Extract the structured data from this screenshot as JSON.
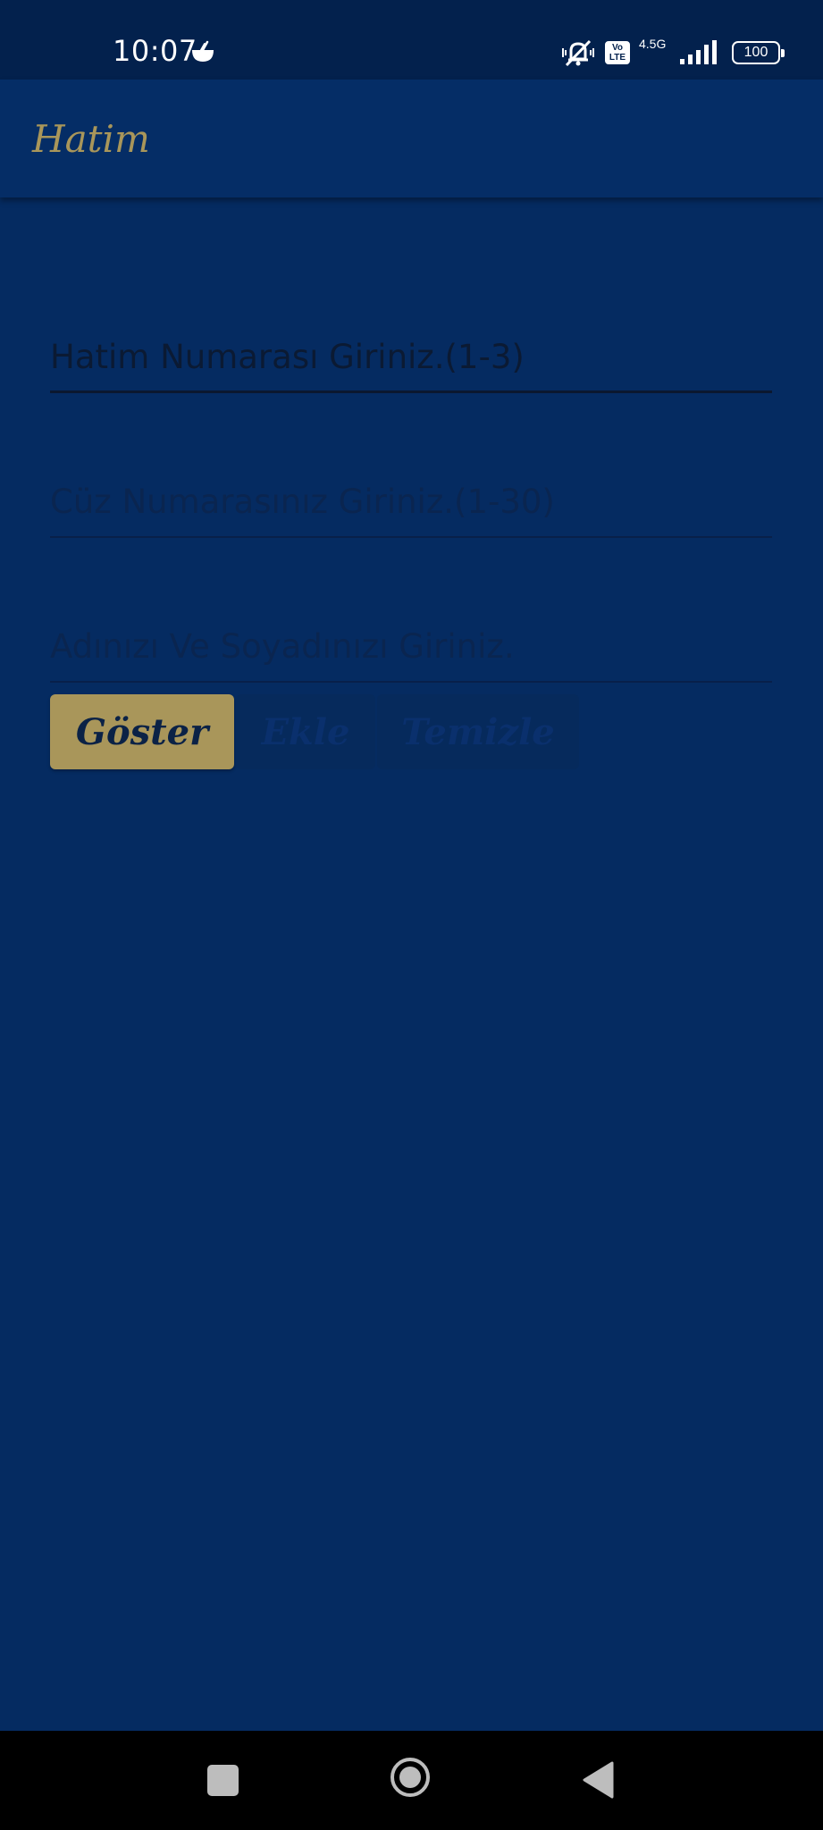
{
  "status_bar": {
    "time": "10:07",
    "notification_icon": "bowl-icon",
    "network_type": "4.5G",
    "volte_label": "Vo LTE",
    "battery_level": "100"
  },
  "app_bar": {
    "title": "Hatim"
  },
  "form": {
    "hatim_field": {
      "placeholder": "Hatim Numarası Giriniz.(1-3)"
    },
    "cuz_field": {
      "placeholder": "Cüz Numarasınız Giriniz.(1-30)"
    },
    "name_field": {
      "placeholder": "Adınızı Ve Soyadınızı Giriniz."
    }
  },
  "buttons": {
    "show": "Göster",
    "add": "Ekle",
    "clear": "Temizle"
  },
  "colors": {
    "background": "#052b61",
    "app_bar": "#052d66",
    "status_bar": "#03214d",
    "accent_gold": "#a9965a",
    "nav_bar": "#000000"
  },
  "nav_bar": {
    "icons": [
      "recents-square-icon",
      "home-circle-icon",
      "back-triangle-icon"
    ]
  }
}
